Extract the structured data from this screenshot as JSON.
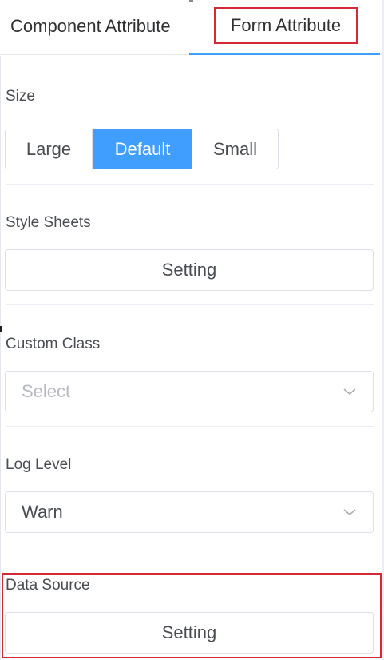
{
  "tabs": {
    "component_label": "Component Attribute",
    "form_label": "Form Attribute"
  },
  "size": {
    "label": "Size",
    "options": [
      "Large",
      "Default",
      "Small"
    ],
    "selected": "Default"
  },
  "style_sheets": {
    "label": "Style Sheets",
    "button_label": "Setting"
  },
  "custom_class": {
    "label": "Custom Class",
    "placeholder": "Select"
  },
  "log_level": {
    "label": "Log Level",
    "value": "Warn"
  },
  "data_source": {
    "label": "Data Source",
    "button_label": "Setting"
  },
  "colors": {
    "accent": "#409eff",
    "highlight": "#d42a35",
    "border": "#dcdfe6"
  }
}
